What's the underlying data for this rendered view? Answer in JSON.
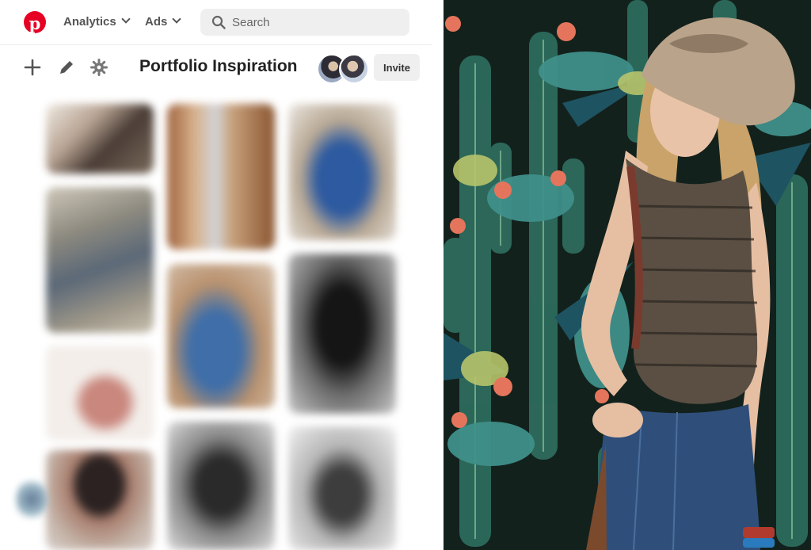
{
  "header": {
    "nav": [
      {
        "label": "Analytics"
      },
      {
        "label": "Ads"
      }
    ],
    "search": {
      "placeholder": "Search"
    }
  },
  "board": {
    "title": "Portfolio Inspiration",
    "invite_label": "Invite"
  },
  "colors": {
    "brand": "#e60023",
    "ui_gray": "#efefef",
    "cactus_dark": "#1d3b2f",
    "cactus_teal": "#3f8f8a",
    "flower_coral": "#e4755c",
    "hat": "#b9a38a",
    "denim": "#2f4f7a"
  },
  "icons": [
    "pinterest-logo-icon",
    "chevron-down-icon",
    "search-icon",
    "plus-icon",
    "edit-pencil-icon",
    "settings-cog-icon"
  ]
}
